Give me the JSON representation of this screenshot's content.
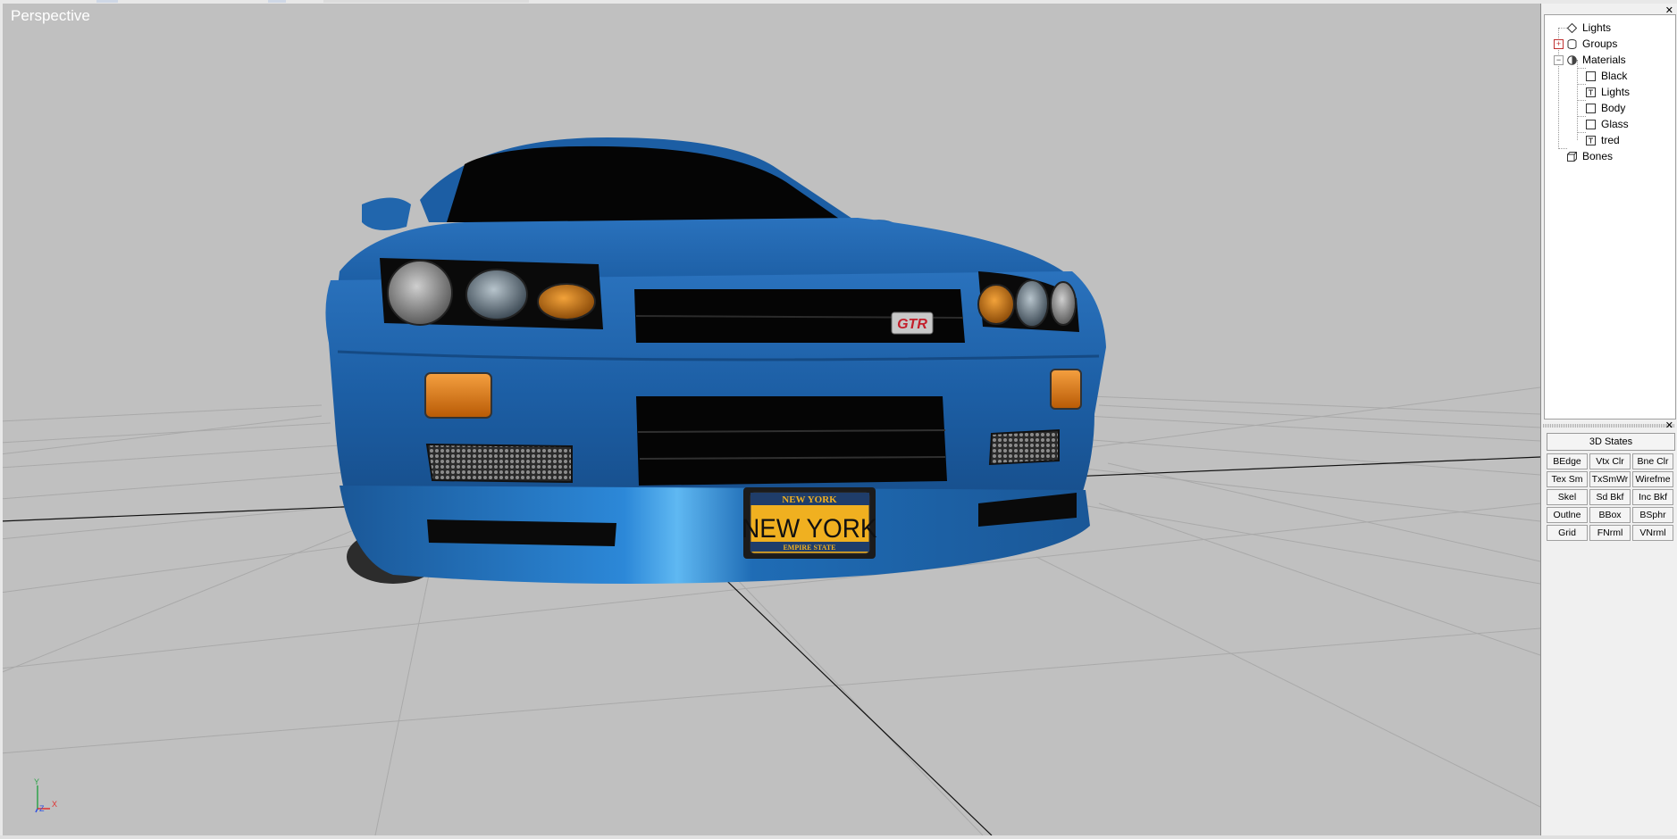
{
  "viewport": {
    "label": "Perspective",
    "background": "#c0c0c0",
    "plate": {
      "top_text": "NEW YORK",
      "main_text": "NEW YORK",
      "bottom_text": "EMPIRE STATE"
    },
    "badge_text": "GTR",
    "axis": {
      "y": "Y",
      "z": "Z",
      "x": "X"
    }
  },
  "scene_tree": {
    "items": [
      {
        "label": "Lights"
      },
      {
        "label": "Groups"
      },
      {
        "label": "Materials"
      },
      {
        "label": "Black"
      },
      {
        "label": "Lights"
      },
      {
        "label": "Body"
      },
      {
        "label": "Glass"
      },
      {
        "label": "tred"
      },
      {
        "label": "Bones"
      }
    ],
    "close_glyph": "✕"
  },
  "states_panel": {
    "close_glyph": "✕",
    "title_button": "3D States",
    "buttons": [
      "BEdge",
      "Vtx Clr",
      "Bne Clr",
      "Tex Sm",
      "TxSmWr",
      "Wirefme",
      "Skel",
      "Sd Bkf",
      "Inc Bkf",
      "Outlne",
      "BBox",
      "BSphr",
      "Grid",
      "FNrml",
      "VNrml"
    ]
  },
  "colors": {
    "car_blue": "#1f63a8",
    "viewport_bg": "#c0c0c0",
    "plate_yellow": "#f0b020",
    "indicator_orange": "#e07a10"
  }
}
